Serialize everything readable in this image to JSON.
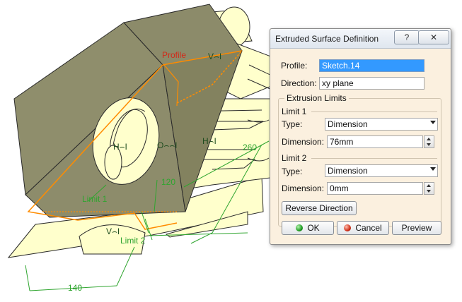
{
  "viewport": {
    "labels": {
      "profile": "Profile",
      "limit1": "Limit 1",
      "limit2": "Limit 2",
      "dim_260": "260",
      "dim_140": "140",
      "dim_120": "120"
    },
    "colors": {
      "part_face": "#8c8b6a",
      "part_body": "#ffffcc",
      "edge": "#2a2a2a",
      "profile_line": "#ff8c00",
      "dimension": "#2fa52f",
      "profile_label": "#d22a1a"
    }
  },
  "dialog": {
    "title": "Extruded Surface Definition",
    "help_label": "?",
    "close_label": "✕",
    "profile_label": "Profile:",
    "profile_value": "Sketch.14",
    "direction_label": "Direction:",
    "direction_value": "xy plane",
    "limits_caption": "Extrusion Limits",
    "limit1": {
      "heading": "Limit 1",
      "type_label": "Type:",
      "type_value": "Dimension",
      "dimension_label": "Dimension:",
      "dimension_value": "76mm"
    },
    "limit2": {
      "heading": "Limit 2",
      "type_label": "Type:",
      "type_value": "Dimension",
      "dimension_label": "Dimension:",
      "dimension_value": "0mm"
    },
    "reverse_label": "Reverse Direction",
    "ok_label": "OK",
    "cancel_label": "Cancel",
    "preview_label": "Preview"
  }
}
